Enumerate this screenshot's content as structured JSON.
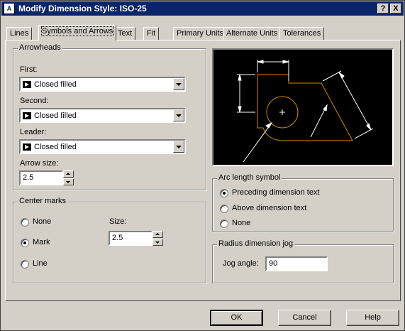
{
  "window": {
    "title": "Modify Dimension Style: ISO-25",
    "help_glyph": "?",
    "close_glyph": "X",
    "icon": "autocad-app-icon"
  },
  "tabs": [
    {
      "label": "Lines"
    },
    {
      "label": "Symbols and Arrows"
    },
    {
      "label": "Text"
    },
    {
      "label": "Fit"
    },
    {
      "label": "Primary Units"
    },
    {
      "label": "Alternate Units"
    },
    {
      "label": "Tolerances"
    }
  ],
  "active_tab": "Symbols and Arrows",
  "arrowheads": {
    "title": "Arrowheads",
    "first_label": "First:",
    "first_value": "Closed filled",
    "second_label": "Second:",
    "second_value": "Closed filled",
    "leader_label": "Leader:",
    "leader_value": "Closed filled",
    "arrow_size_label": "Arrow size:",
    "arrow_size_value": "2.5"
  },
  "center_marks": {
    "title": "Center marks",
    "options": [
      {
        "label": "None",
        "selected": false
      },
      {
        "label": "Mark",
        "selected": true
      },
      {
        "label": "Line",
        "selected": false
      }
    ],
    "size_label": "Size:",
    "size_value": "2.5"
  },
  "arc_length_symbol": {
    "title": "Arc length symbol",
    "options": [
      {
        "label": "Preceding dimension text",
        "selected": true
      },
      {
        "label": "Above dimension text",
        "selected": false
      },
      {
        "label": "None",
        "selected": false
      }
    ]
  },
  "radius_jog": {
    "title": "Radius dimension jog",
    "jog_label": "Jog angle:",
    "jog_value": "90"
  },
  "buttons": {
    "ok": "OK",
    "cancel": "Cancel",
    "help": "Help"
  },
  "colors": {
    "title_bar": "#0a246a",
    "preview_bg": "#000000",
    "preview_geometry": "#d08a00",
    "preview_dimensions": "#ffffff"
  }
}
